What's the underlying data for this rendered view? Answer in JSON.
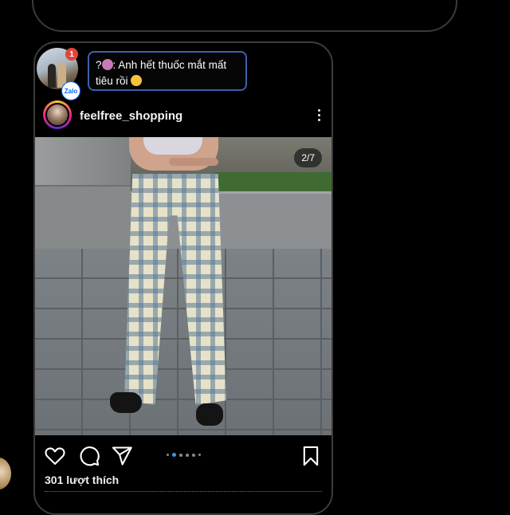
{
  "chat": {
    "notification": {
      "badge_count": "1",
      "app_badge": "Zalo",
      "message_text": "? : Anh hết thuốc mắt mất tiêu rồi",
      "message_prefix": "?",
      "message_body": ": Anh hết thuốc mắt mất tiêu rồi"
    }
  },
  "post": {
    "username": "feelfree_shopping",
    "image_counter": "2/7",
    "carousel_index": 2,
    "carousel_total": 7,
    "likes_text": "301 lượt thích"
  },
  "colors": {
    "background": "#000000",
    "accent_blue": "#3897f0",
    "bubble_border": "#3d5fae",
    "badge_red": "#e0453b"
  },
  "icons": [
    "heart-icon",
    "comment-icon",
    "share-icon",
    "bookmark-icon",
    "more-icon"
  ]
}
